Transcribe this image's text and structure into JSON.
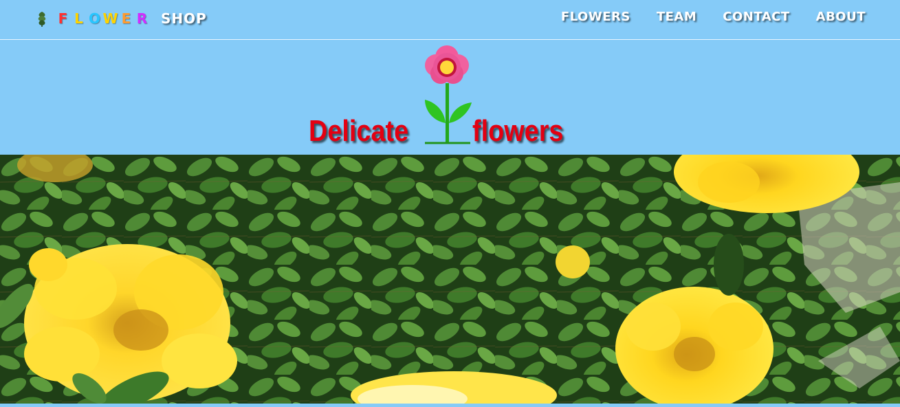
{
  "brand": {
    "letters": [
      "F",
      "L",
      "O",
      "W",
      "E",
      "R"
    ],
    "letter_colors": [
      "#ff3030",
      "#ffd400",
      "#27c6ff",
      "#ffd400",
      "#ff9a2e",
      "#d12cff"
    ],
    "shop_label": "SHOP",
    "icon": "leaf-icon"
  },
  "nav": {
    "items": [
      {
        "label": "FLOWERS"
      },
      {
        "label": "TEAM"
      },
      {
        "label": "CONTACT"
      },
      {
        "label": "ABOUT"
      }
    ]
  },
  "banner": {
    "title_left": "Delicate",
    "title_right": "flowers",
    "icon": "flower-icon",
    "title_color": "#e30012"
  },
  "hero": {
    "description": "",
    "icon": "rose-bush-photo"
  },
  "colors": {
    "background": "#85cbf8",
    "nav_text": "#ffffff"
  }
}
